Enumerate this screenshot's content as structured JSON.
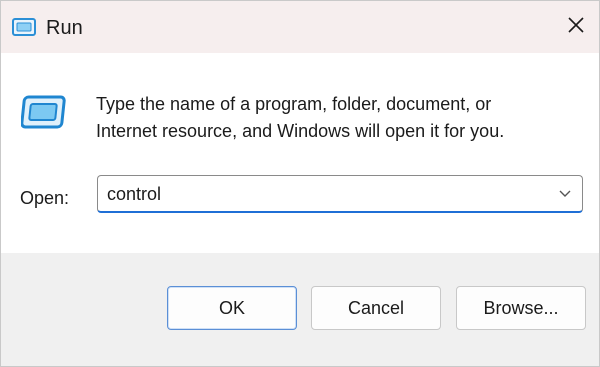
{
  "window": {
    "title": "Run",
    "title_icon": "run-icon",
    "close_icon": "close-icon"
  },
  "content": {
    "icon": "run-icon",
    "description_line1": "Type the name of a program, folder, document, or",
    "description_line2": "Internet resource, and Windows will open it for you.",
    "open_label": "Open:",
    "open_value": "control",
    "dropdown_icon": "chevron-down-icon"
  },
  "buttons": {
    "ok": "OK",
    "cancel": "Cancel",
    "browse": "Browse..."
  },
  "colors": {
    "accent": "#1f6fd6",
    "titlebar": "#f6eeee",
    "content_bg": "#ffffff",
    "footer_bg": "#f0f0f0"
  }
}
